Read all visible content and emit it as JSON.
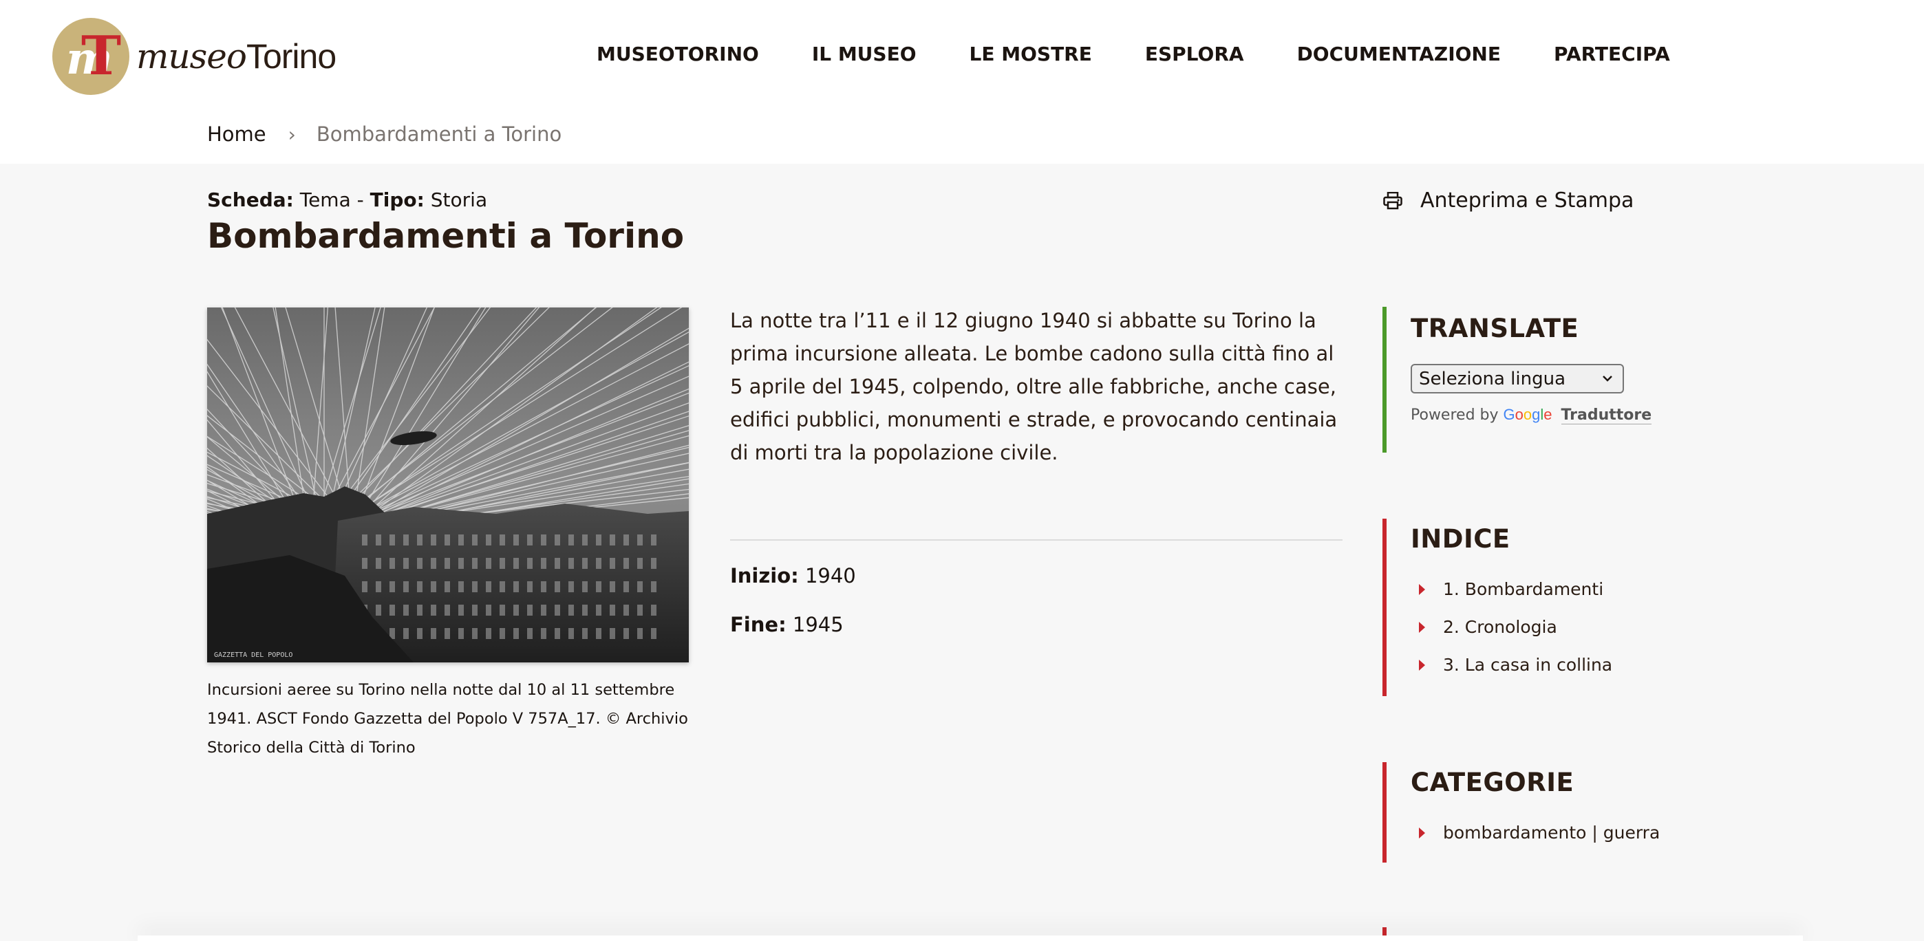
{
  "logo": {
    "badge_letters": "mT",
    "text_italic": "museo",
    "text_regular": "Torino"
  },
  "nav": [
    {
      "label": "MUSEOTORINO"
    },
    {
      "label": "IL MUSEO"
    },
    {
      "label": "LE MOSTRE"
    },
    {
      "label": "ESPLORA"
    },
    {
      "label": "DOCUMENTAZIONE"
    },
    {
      "label": "PARTECIPA"
    }
  ],
  "breadcrumb": {
    "home": "Home",
    "separator": "›",
    "current": "Bombardamenti a Torino"
  },
  "scheda": {
    "scheda_label": "Scheda:",
    "scheda_value": "Tema",
    "dash": "-",
    "tipo_label": "Tipo:",
    "tipo_value": "Storia"
  },
  "page_title": "Bombardamenti a Torino",
  "print_link": {
    "label": "Anteprima e Stampa",
    "icon": "printer-icon"
  },
  "photo": {
    "caption": "Incursioni aeree su Torino nella notte dal 10 al 11 settembre 1941. ASCT Fondo Gazzetta del Popolo V 757A_17. © Archivio Storico della Città di Torino",
    "watermark": "GAZZETTA DEL POPOLO"
  },
  "intro": "La notte tra l’11 e il 12 giugno 1940 si abbatte su Torino la prima incursione alleata. Le bombe cadono sulla città fino al 5 aprile del 1945, colpendo, oltre alle fabbriche, anche case, edifici pubblici, monumenti e strade, e provocando centinaia di morti tra la popolazione civile.",
  "dates": {
    "inizio_label": "Inizio:",
    "inizio_value": "1940",
    "fine_label": "Fine:",
    "fine_value": "1945"
  },
  "translate": {
    "title": "TRANSLATE",
    "select_value": "Seleziona lingua",
    "powered_by": "Powered by",
    "google": "Google",
    "translator": "Traduttore"
  },
  "indice": {
    "title": "INDICE",
    "items": [
      {
        "label": "1. Bombardamenti"
      },
      {
        "label": "2. Cronologia"
      },
      {
        "label": "3. La casa in collina"
      }
    ]
  },
  "categorie": {
    "title": "CATEGORIE",
    "items": [
      {
        "label": "bombardamento | guerra"
      }
    ]
  },
  "colors": {
    "accent_red": "#c8262d",
    "accent_green": "#4c9a2a",
    "logo_gold": "#c9b37a",
    "text_dark": "#2b1d14"
  }
}
